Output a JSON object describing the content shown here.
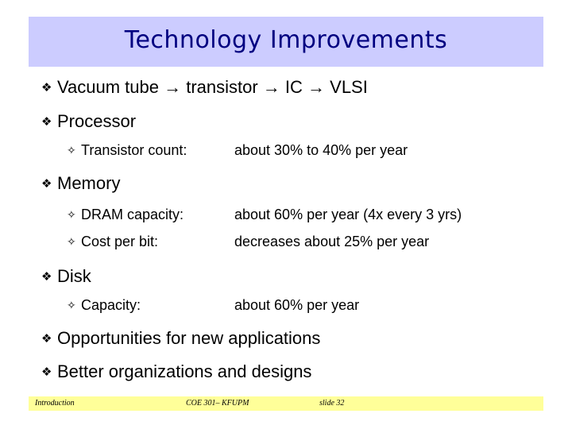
{
  "slide": {
    "title": "Technology Improvements",
    "bullets": [
      {
        "bullet_icon": "❖",
        "text": "Vacuum tube → transistor → IC → VLSI"
      },
      {
        "bullet_icon": "❖",
        "text": "Processor",
        "sub": [
          {
            "bullet_icon": "✧",
            "label": "Transistor count:",
            "value": "about 30% to 40% per year"
          }
        ]
      },
      {
        "bullet_icon": "❖",
        "text": "Memory",
        "sub": [
          {
            "bullet_icon": "✧",
            "label": "DRAM capacity:",
            "value": "about 60% per year (4x every 3 yrs)"
          },
          {
            "bullet_icon": "✧",
            "label": "Cost per bit:",
            "value": "decreases about 25% per year"
          }
        ]
      },
      {
        "bullet_icon": "❖",
        "text": "Disk",
        "sub": [
          {
            "bullet_icon": "✧",
            "label": "Capacity:",
            "value": "about 60% per year"
          }
        ]
      },
      {
        "bullet_icon": "❖",
        "text": "Opportunities for new applications"
      },
      {
        "bullet_icon": "❖",
        "text": "Better organizations and designs"
      }
    ]
  },
  "footer": {
    "section": "Introduction",
    "course": "COE 301– KFUPM",
    "slide_number": "slide 32"
  },
  "colors": {
    "title_band": "#ccccff",
    "title_text": "#000080",
    "footer_band": "#ffff99",
    "body_text": "#000000"
  }
}
